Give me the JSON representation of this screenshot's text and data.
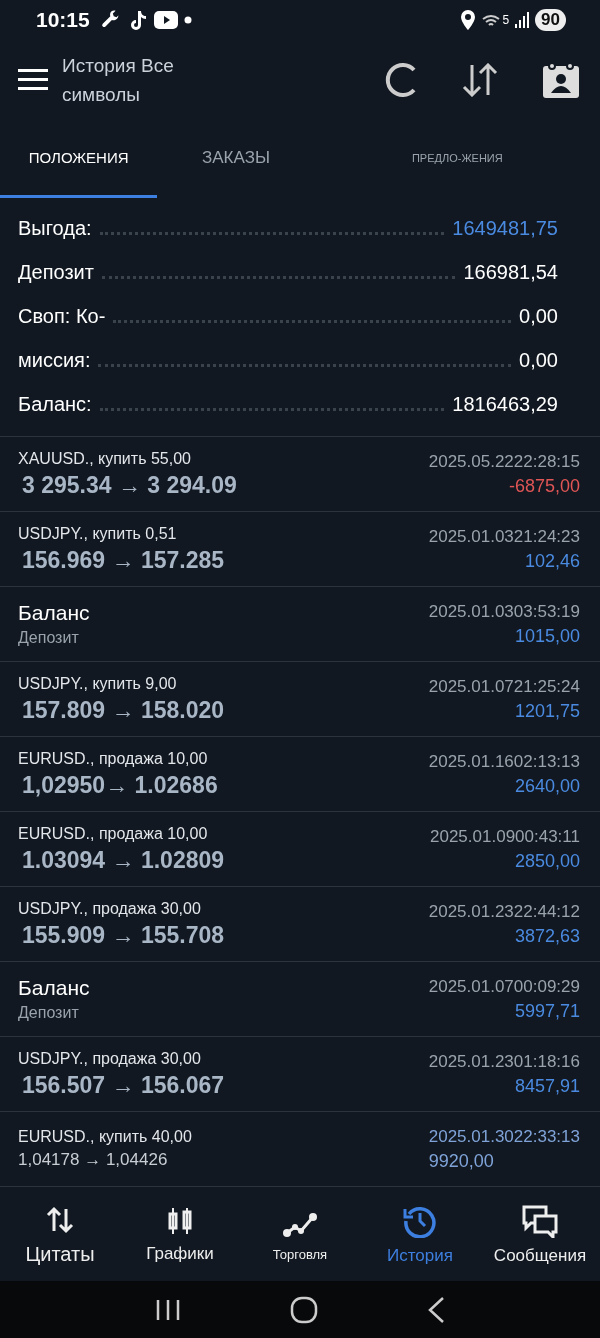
{
  "status_bar": {
    "time": "10:15",
    "network": "5",
    "battery": "90"
  },
  "header": {
    "title": "История Все символы"
  },
  "tabs": [
    {
      "label": "ПОЛОЖЕНИЯ",
      "selected": true
    },
    {
      "label": "ЗАКАЗЫ",
      "selected": false
    },
    {
      "label": "ПРЕДЛО-ЖЕНИЯ",
      "selected": false
    }
  ],
  "summary": [
    {
      "label": "Выгода:",
      "value": "1649481,75",
      "highlight": true
    },
    {
      "label": "Депозит",
      "value": "166981,54",
      "highlight": false
    },
    {
      "label": "Своп: Ко-",
      "value": "0,00",
      "highlight": false
    },
    {
      "label": "миссия:",
      "value": "0,00",
      "highlight": false
    },
    {
      "label": "Баланс:",
      "value": "1816463,29",
      "highlight": false
    }
  ],
  "rows": [
    {
      "kind": "trade",
      "title": "XAUUSD., купить 55,00",
      "prices": "3 295.34 → 3 294.09",
      "time": "2025.05.2222:28:15",
      "amount": "-6875,00",
      "loss": true
    },
    {
      "kind": "trade",
      "title": "USDJPY., купить 0,51",
      "prices": "156.969 → 157.285",
      "time": "2025.01.0321:24:23",
      "amount": "102,46",
      "loss": false
    },
    {
      "kind": "balance",
      "title": "Баланс",
      "subtitle": "Депозит",
      "time": "2025.01.0303:53:19",
      "amount": "1015,00",
      "loss": false
    },
    {
      "kind": "trade",
      "title": "USDJPY., купить 9,00",
      "prices": "157.809 → 158.020",
      "time": "2025.01.0721:25:24",
      "amount": "1201,75",
      "loss": false
    },
    {
      "kind": "trade",
      "title": "EURUSD., продажа 10,00",
      "prices": "1,02950→ 1.02686",
      "time": "2025.01.1602:13:13",
      "amount": "2640,00",
      "loss": false
    },
    {
      "kind": "trade",
      "title": "EURUSD., продажа 10,00",
      "prices": "1.03094 → 1.02809",
      "time": "2025.01.0900:43:11",
      "amount": "2850,00",
      "loss": false
    },
    {
      "kind": "trade",
      "title": "USDJPY., продажа 30,00",
      "prices": "155.909 → 155.708",
      "time": "2025.01.2322:44:12",
      "amount": "3872,63",
      "loss": false
    },
    {
      "kind": "balance",
      "title": "Баланс",
      "subtitle": "Депозит",
      "time": "2025.01.0700:09:29",
      "amount": "5997,71",
      "loss": false
    },
    {
      "kind": "trade",
      "title": "USDJPY., продажа 30,00",
      "prices": "156.507 → 156.067",
      "time": "2025.01.2301:18:16",
      "amount": "8457,91",
      "loss": false
    },
    {
      "kind": "plain",
      "title": "EURUSD., купить 40,00",
      "prices": "1,04178 → 1,04426",
      "time": "2025.01.3022:33:13",
      "amount": "9920,00",
      "loss": false
    }
  ],
  "bottom_nav": [
    {
      "label": "Цитаты",
      "selected": false
    },
    {
      "label": "Графики",
      "selected": false
    },
    {
      "label": "Торговля",
      "selected": false
    },
    {
      "label": "История",
      "selected": true
    },
    {
      "label": "Сообщения",
      "selected": false
    }
  ]
}
